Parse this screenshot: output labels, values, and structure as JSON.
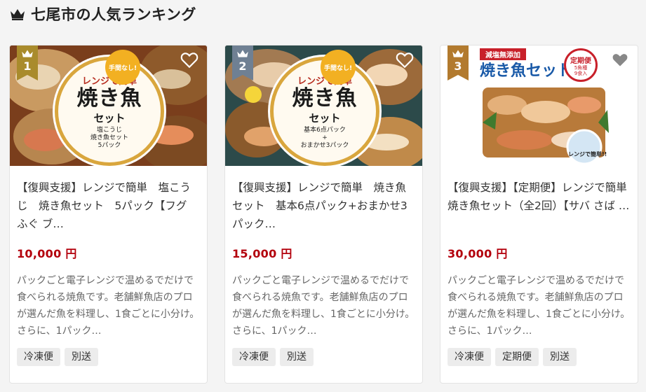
{
  "header": {
    "title": "七尾市の人気ランキング"
  },
  "cards": [
    {
      "rank": "1",
      "name": "【復興支援】レンジで簡単　塩こうじ　焼き魚セット　5パック【フグ ふぐ ブ…",
      "price": "10,000 円",
      "description": "パックごと電子レンジで温めるでだけで食べられる焼魚です。老舗鮮魚店のプロが選んだ魚を料理し、1食ごとに小分け。さらに、1パック…",
      "tags": [
        "冷凍便",
        "別送"
      ],
      "image_text": {
        "top": "レンジで簡単",
        "big": "焼き魚",
        "mid": "セット",
        "small": "塩こうじ\n焼き魚セット\n5パック",
        "badge": "手間なし!"
      }
    },
    {
      "rank": "2",
      "name": "【復興支援】レンジで簡単　焼き魚セット　基本6点パック+おまかせ3パック…",
      "price": "15,000 円",
      "description": "パックごと電子レンジで温めるでだけで食べられる焼魚です。老舗鮮魚店のプロが選んだ魚を料理し、1食ごとに小分け。さらに、1パック…",
      "tags": [
        "冷凍便",
        "別送"
      ],
      "image_text": {
        "top": "レンジで簡単",
        "big": "焼き魚",
        "mid": "セット",
        "small": "基本6点パック\n+\nおまかせ3パック",
        "badge": "手間なし!"
      }
    },
    {
      "rank": "3",
      "name": "【復興支援】【定期便】レンジで簡単　焼き魚セット（全2回）【サバ さば …",
      "price": "30,000 円",
      "description": "パックごと電子レンジで温めるでだけで食べられる焼魚です。老舗鮮魚店のプロが選んだ魚を料理し、1食ごとに小分け。さらに、1パック…",
      "tags": [
        "冷凍便",
        "定期便",
        "別送"
      ],
      "image_text": {
        "label": "減塩無添加",
        "title": "焼き魚セット",
        "plan": "定期便",
        "plan_sub": "5魚種\n9食入",
        "corner": "レンジで簡単!!"
      }
    }
  ],
  "colors": {
    "gold": "#a98b2c",
    "silver": "#6f8093",
    "bronze": "#b27a2e",
    "price": "#b3000c"
  }
}
